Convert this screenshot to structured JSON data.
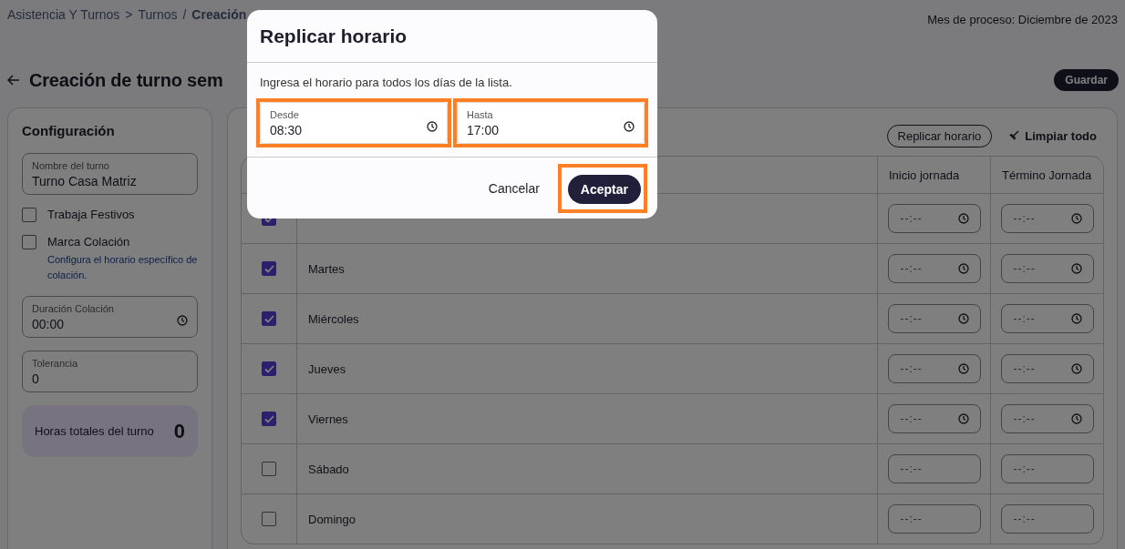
{
  "breadcrumb": [
    {
      "text": "Asistencia Y Turnos",
      "kind": "link"
    },
    {
      "text": ">",
      "kind": "separator"
    },
    {
      "text": "Turnos",
      "kind": "link"
    },
    {
      "text": "/",
      "kind": "separator"
    },
    {
      "text": "Creación",
      "kind": "current"
    }
  ],
  "process_month": "Mes de proceso: Diciembre de 2023",
  "page_title": "Creación de turno sem",
  "save_button": "Guardar",
  "config": {
    "title": "Configuración",
    "items": [
      {
        "kind": "field",
        "label": "Nombre del turno",
        "value": "Turno Casa Matriz"
      },
      {
        "kind": "checkbox",
        "label": "Trabaja Festivos",
        "checked": false
      },
      {
        "kind": "checkbox",
        "label": "Marca Colación",
        "checked": false,
        "hint": "Configura el horario específico de colación."
      },
      {
        "kind": "time",
        "label": "Duración Colación",
        "value": "00:00"
      },
      {
        "kind": "field",
        "label": "Tolerancia",
        "value": "0"
      },
      {
        "kind": "total",
        "label": "Horas totales del turno",
        "value": "0"
      }
    ]
  },
  "schedule": {
    "replicate_button": "Replicar horario",
    "clear_button": "Limpiar todo",
    "columns": [
      "Inicio jornada",
      "Término Jornada"
    ],
    "rows": [
      {
        "checked": true,
        "start": {
          "placeholder": "--:--"
        },
        "end": {
          "placeholder": "--:--"
        }
      },
      {
        "day": "Martes",
        "checked": true,
        "start": {
          "placeholder": "--:--"
        },
        "end": {
          "placeholder": "--:--"
        }
      },
      {
        "day": "Miércoles",
        "checked": true,
        "start": {
          "placeholder": "--:--"
        },
        "end": {
          "placeholder": "--:--"
        }
      },
      {
        "day": "Jueves",
        "checked": true,
        "start": {
          "placeholder": "--:--"
        },
        "end": {
          "placeholder": "--:--"
        }
      },
      {
        "day": "Viernes",
        "checked": true,
        "start": {
          "placeholder": "--:--"
        },
        "end": {
          "placeholder": "--:--"
        }
      },
      {
        "day": "Sábado",
        "checked": false,
        "start": {
          "placeholder": "--:--"
        },
        "end": {
          "placeholder": "--:--"
        }
      },
      {
        "day": "Domingo",
        "checked": false,
        "start": {
          "placeholder": "--:--"
        },
        "end": {
          "placeholder": "--:--"
        }
      }
    ]
  },
  "dialog": {
    "title": "Replicar horario",
    "text": "Ingresa el horario para todos los días de la lista.",
    "fields": [
      {
        "label": "Desde",
        "value": "08:30",
        "highlighted": true
      },
      {
        "label": "Hasta",
        "value": "17:00",
        "highlighted": true
      }
    ],
    "cancel_button": "Cancelar",
    "accept_button": {
      "label": "Aceptar",
      "highlighted": true
    }
  }
}
